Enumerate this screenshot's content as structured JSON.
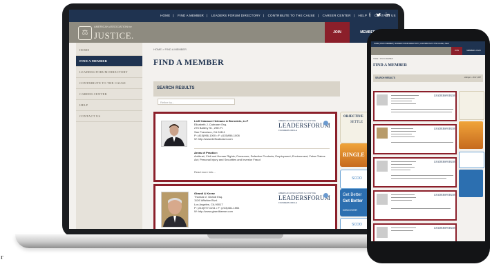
{
  "site": {
    "top_nav": [
      "HOME",
      "FIND A MEMBER",
      "LEADERS FORUM DIRECTORY",
      "CONTRIBUTE TO THE CAUSE",
      "CAREER CENTER",
      "HELP",
      "CONTACT US"
    ],
    "social_icons": [
      "facebook-icon",
      "twitter-icon",
      "linkedin-icon"
    ],
    "logo_small": "AMERICAN ASSOCIATION for",
    "logo_big": "JUSTICE.",
    "join_label": "JOIN",
    "member_login_label": "MEMBER LOGIN"
  },
  "sidebar": {
    "items": [
      {
        "label": "HOME"
      },
      {
        "label": "FIND A MEMBER"
      },
      {
        "label": "LEADERS FORUM DIRECTORY"
      },
      {
        "label": "CONTRIBUTE TO THE CAUSE"
      },
      {
        "label": "CAREER CENTER"
      },
      {
        "label": "HELP"
      },
      {
        "label": "CONTACT US"
      }
    ]
  },
  "main": {
    "breadcrumb": "HOME > FIND A MEMBER",
    "title": "FIND A MEMBER",
    "results_heading": "SEARCH RESULTS",
    "listings_text": "Listings 1 - 20 of",
    "listings_sub": "Return to",
    "refine_placeholder": "Refine by..."
  },
  "leaders_forum": {
    "line1": "AMERICAN ASSOCIATION for JUSTICE",
    "line2": "LEADERSFORUM",
    "line3": "FOUNDERS CIRCLE"
  },
  "results": [
    {
      "firm": "Lieff Cabraser Heimann & Bernstein, LLP",
      "name": "Elizabeth J. Cabraser Esq.",
      "address1": "275 Battery St., 29th Fl.",
      "address2": "San Francisco, CA 94111",
      "phone": "P: (415)956-1000 • F: (415)956-1008",
      "web": "W: http://www.lieffcabraser.com",
      "practice_heading": "Areas of Practice:",
      "practice": "Antitrust; Civil and Human Rights; Consumer; Defective Products; Employment; Environment; False Claims Act; Personal Injury and Securities and Investor Fraud",
      "read_more": "Read more info..."
    },
    {
      "firm": "Girardi & Keese",
      "name": "Thomas V. Girardi Esq.",
      "address1": "1126 Wilshire Blvd.",
      "address2": "Los Angeles, CA 90017",
      "phone": "P: (213)977-0211 • F: (213)481-1554",
      "web": "W: http://www.girardikeese.com"
    }
  ],
  "ads": [
    {
      "title": "OBJECTIVE",
      "sub": "SETTLE"
    },
    {
      "title": "RINGLE",
      "sub": ""
    },
    {
      "title": "SCOO",
      "sub": ""
    },
    {
      "title": "Get Better",
      "sub": "Get Better"
    },
    {
      "title": "DISCOVER",
      "sub": ""
    },
    {
      "title": "SCOO",
      "sub": ""
    }
  ],
  "phone": {
    "title": "FIND A MEMBER",
    "results_heading": "SEARCH RESULTS",
    "listings_text": "Listings 1 - 20 of 1,007",
    "lf_label": "LEADERSFORUM"
  },
  "footer_glyph": "r"
}
